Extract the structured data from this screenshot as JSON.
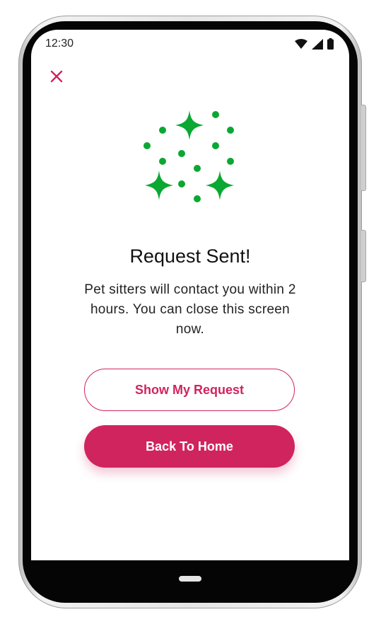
{
  "status_bar": {
    "time": "12:30",
    "icons": [
      "wifi-icon",
      "cell-signal-icon",
      "battery-icon"
    ]
  },
  "header": {
    "close_icon": "close-icon"
  },
  "illustration": {
    "icon": "sparkles-icon",
    "color": "#0aa832"
  },
  "content": {
    "title": "Request Sent!",
    "message": "Pet sitters will contact you within 2 hours. You can close this screen now."
  },
  "actions": {
    "show_request_label": "Show My Request",
    "back_home_label": "Back To Home"
  },
  "colors": {
    "accent": "#d0245f",
    "success": "#0aa832"
  }
}
